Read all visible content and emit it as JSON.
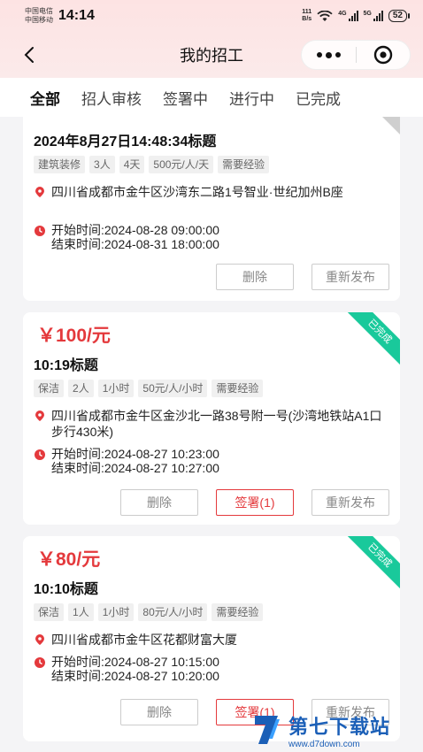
{
  "status_bar": {
    "carrier1": "中国电信",
    "carrier2": "中国移动",
    "time": "14:14",
    "speed_value": "111",
    "speed_unit": "B/s",
    "net1": "4G",
    "net2": "5G",
    "battery": "52"
  },
  "nav": {
    "title": "我的招工"
  },
  "tabs": [
    "全部",
    "招人审核",
    "签署中",
    "进行中",
    "已完成"
  ],
  "cards": [
    {
      "title": "2024年8月27日14:48:34标题",
      "tags": [
        "建筑装修",
        "3人",
        "4天",
        "500元/人/天",
        "需要经验"
      ],
      "address": "四川省成都市金牛区沙湾东二路1号智业·世纪加州B座",
      "start": "开始时间:2024-08-28 09:00:00",
      "end": "结束时间:2024-08-31 18:00:00",
      "btn_delete": "删除",
      "btn_republish": "重新发布"
    },
    {
      "price": "￥100/元",
      "title": "10:19标题",
      "badge": "已完成",
      "tags": [
        "保洁",
        "2人",
        "1小时",
        "50元/人/小时",
        "需要经验"
      ],
      "address": "四川省成都市金牛区金沙北一路38号附一号(沙湾地铁站A1口步行430米)",
      "start": "开始时间:2024-08-27 10:23:00",
      "end": "结束时间:2024-08-27 10:27:00",
      "btn_delete": "删除",
      "btn_sign": "签署(1)",
      "btn_republish": "重新发布"
    },
    {
      "price": "￥80/元",
      "title": "10:10标题",
      "badge": "已完成",
      "tags": [
        "保洁",
        "1人",
        "1小时",
        "80元/人/小时",
        "需要经验"
      ],
      "address": "四川省成都市金牛区花都财富大厦",
      "start": "开始时间:2024-08-27 10:15:00",
      "end": "结束时间:2024-08-27 10:20:00",
      "btn_delete": "删除",
      "btn_sign": "签署(1)",
      "btn_republish": "重新发布"
    }
  ],
  "watermark": {
    "main": "第七下载站",
    "sub": "www.d7down.com"
  },
  "colors": {
    "accent": "#e4393c",
    "badge": "#19c99b",
    "watermark": "#1b5fb7"
  }
}
